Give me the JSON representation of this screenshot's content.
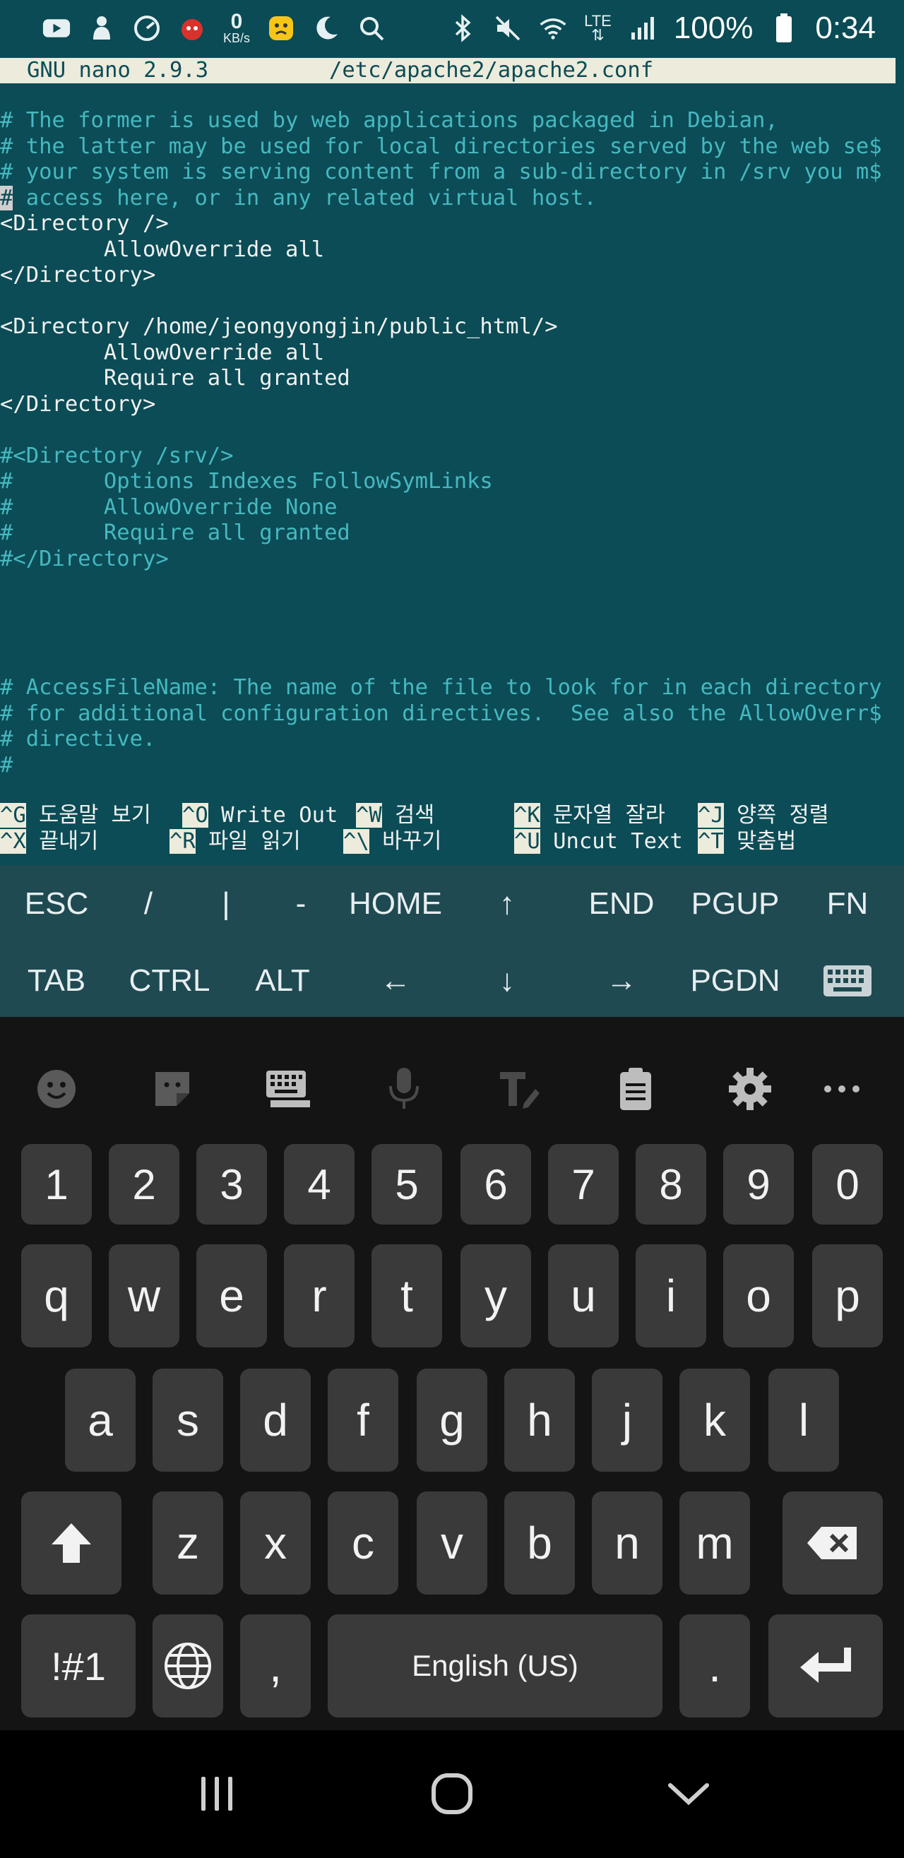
{
  "status_bar": {
    "icons_left": [
      "youtube-icon",
      "app-icon",
      "speedometer-icon",
      "bug-icon",
      "emoji-icon",
      "moon-icon",
      "search-icon"
    ],
    "net_speed_value": "0",
    "net_speed_unit": "KB/s",
    "icons_right": [
      "bluetooth-icon",
      "mute-icon",
      "wifi-icon",
      "lte-icon",
      "signal-icon",
      "battery-icon"
    ],
    "lte_label": "LTE",
    "battery": "100%",
    "time": "0:34"
  },
  "nano": {
    "version": "GNU nano 2.9.3",
    "filename": "/etc/apache2/apache2.conf",
    "lines": [
      "# The former is used by web applications packaged in Debian,",
      "# the latter may be used for local directories served by the web se$",
      "# your system is serving content from a sub-directory in /srv you m$",
      " access here, or in any related virtual host.",
      "<Directory />",
      "        AllowOverride all",
      "</Directory>",
      "",
      "<Directory /home/jeongyongjin/public_html/>",
      "        AllowOverride all",
      "        Require all granted",
      "</Directory>",
      "",
      "#<Directory /srv/>",
      "#       Options Indexes FollowSymLinks",
      "#       AllowOverride None",
      "#       Require all granted",
      "#</Directory>",
      "",
      "",
      "",
      "",
      "# AccessFileName: The name of the file to look for in each directory",
      "# for additional configuration directives.  See also the AllowOverr$",
      "# directive.",
      "#"
    ],
    "cursor_char": "#",
    "help": [
      {
        "key": "^G",
        "label": "도움말 보기"
      },
      {
        "key": "^O",
        "label": "Write Out"
      },
      {
        "key": "^W",
        "label": "검색"
      },
      {
        "key": "^K",
        "label": "문자열 잘라"
      },
      {
        "key": "^J",
        "label": "양쪽 정렬"
      },
      {
        "key": "^X",
        "label": "끝내기"
      },
      {
        "key": "^R",
        "label": "파일 읽기"
      },
      {
        "key": "^\\",
        "label": "바꾸기"
      },
      {
        "key": "^U",
        "label": "Uncut Text"
      },
      {
        "key": "^T",
        "label": "맞춤법"
      }
    ]
  },
  "extra_keys": {
    "row1": [
      "ESC",
      "/",
      "|",
      "-",
      "HOME",
      "↑",
      "END",
      "PGUP",
      "FN"
    ],
    "row2": [
      "TAB",
      "CTRL",
      "ALT",
      "←",
      "↓",
      "→",
      "PGDN"
    ],
    "keyboard_toggle_icon": "keyboard-icon"
  },
  "keyboard": {
    "toolbar_icons": [
      "emoji-icon",
      "sticker-icon",
      "keyboard-layout-icon",
      "microphone-icon",
      "text-style-icon",
      "clipboard-icon",
      "settings-icon",
      "more-icon"
    ],
    "numbers": [
      "1",
      "2",
      "3",
      "4",
      "5",
      "6",
      "7",
      "8",
      "9",
      "0"
    ],
    "row_q": [
      "q",
      "w",
      "e",
      "r",
      "t",
      "y",
      "u",
      "i",
      "o",
      "p"
    ],
    "row_a": [
      "a",
      "s",
      "d",
      "f",
      "g",
      "h",
      "j",
      "k",
      "l"
    ],
    "row_z": [
      "z",
      "x",
      "c",
      "v",
      "b",
      "n",
      "m"
    ],
    "symbols_label": "!#1",
    "comma": ",",
    "space_label": "English (US)",
    "period": "."
  },
  "nav_bar": {
    "icons": [
      "recents-icon",
      "home-icon",
      "back-icon"
    ]
  }
}
